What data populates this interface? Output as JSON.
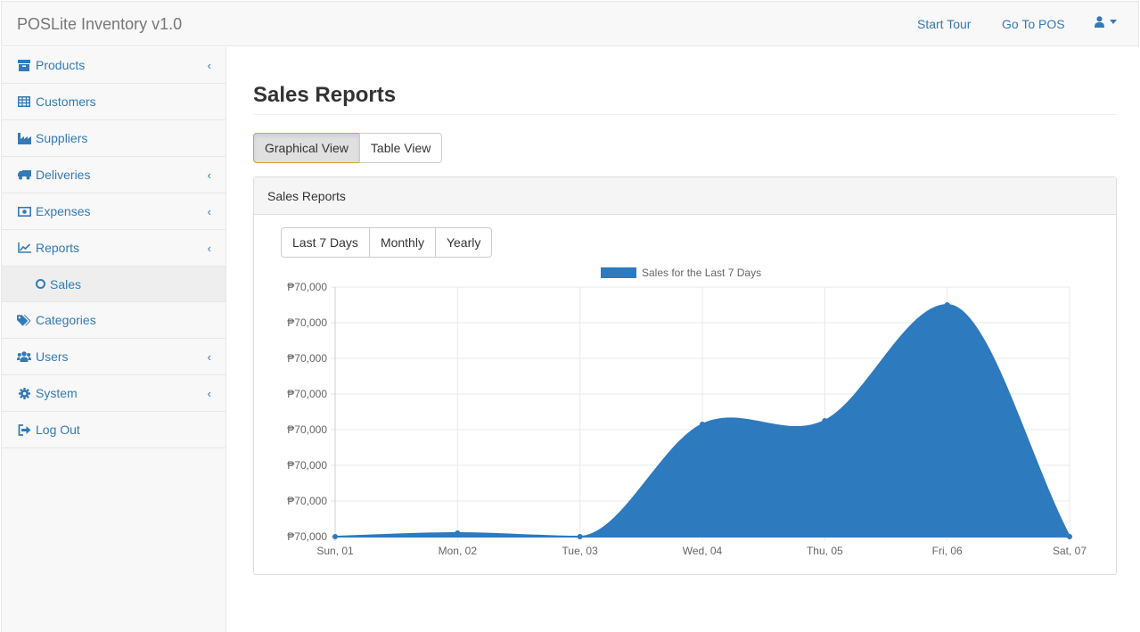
{
  "navbar": {
    "brand": "POSLite Inventory v1.0",
    "start_tour": "Start Tour",
    "go_to_pos": "Go To POS",
    "user_icon": "user-icon"
  },
  "sidebar": {
    "items": [
      {
        "label": "Products",
        "icon": "archive-icon",
        "chevron": true
      },
      {
        "label": "Customers",
        "icon": "table-icon",
        "chevron": false
      },
      {
        "label": "Suppliers",
        "icon": "industry-icon",
        "chevron": false
      },
      {
        "label": "Deliveries",
        "icon": "truck-icon",
        "chevron": true
      },
      {
        "label": "Expenses",
        "icon": "money-icon",
        "chevron": true
      },
      {
        "label": "Reports",
        "icon": "line-chart-icon",
        "chevron": true
      },
      {
        "label": "Categories",
        "icon": "tags-icon",
        "chevron": false
      },
      {
        "label": "Users",
        "icon": "users-icon",
        "chevron": true
      },
      {
        "label": "System",
        "icon": "gear-icon",
        "chevron": true
      },
      {
        "label": "Log Out",
        "icon": "sign-out-icon",
        "chevron": false
      }
    ],
    "sub_sales": "Sales",
    "chevron_glyph": "‹"
  },
  "main": {
    "title": "Sales Reports",
    "views": [
      "Graphical View",
      "Table View"
    ],
    "active_view": "Graphical View",
    "panel_title": "Sales Reports",
    "ranges": [
      "Last 7 Days",
      "Monthly",
      "Yearly"
    ]
  },
  "colors": {
    "accent": "#337ab7",
    "series": "#2e7abf"
  },
  "chart_data": {
    "type": "area",
    "legend": "Sales for the Last 7 Days",
    "legend_position": "top",
    "categories": [
      "Sun, 01",
      "Mon, 02",
      "Tue, 03",
      "Wed, 04",
      "Thu, 05",
      "Fri, 06",
      "Sat, 07"
    ],
    "series": [
      {
        "name": "Sales for the Last 7 Days",
        "values": [
          0,
          1,
          0,
          31.5,
          32.5,
          65,
          0
        ]
      }
    ],
    "y_tick_labels": [
      "₱70,000",
      "₱70,000",
      "₱70,000",
      "₱70,000",
      "₱70,000",
      "₱70,000",
      "₱70,000",
      "₱70,000"
    ],
    "ylim": [
      0,
      70
    ],
    "grid": true
  }
}
